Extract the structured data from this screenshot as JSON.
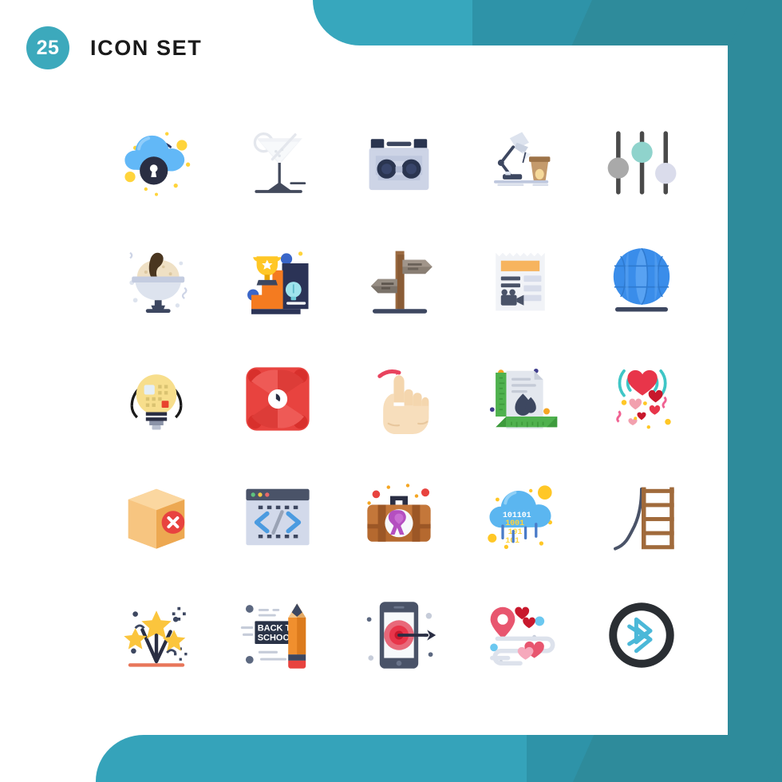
{
  "header": {
    "count_badge": "25",
    "title": "ICON SET"
  },
  "theme": {
    "teal_dark": "#2E8B9B",
    "teal_mid": "#2E93A8",
    "teal_light": "#37A7BD",
    "badge_bg": "#3CA9BC",
    "panel_bg": "#FFFFFF",
    "title_color": "#1A1A1A"
  },
  "grid": {
    "columns": 5,
    "rows": 5,
    "total_icons": 25
  },
  "icons": [
    {
      "index": 1,
      "row": 1,
      "col": 1,
      "name": "cloud-lock-icon",
      "label": "Cloud Security"
    },
    {
      "index": 2,
      "row": 1,
      "col": 2,
      "name": "cocktail-glass-icon",
      "label": "Cocktail"
    },
    {
      "index": 3,
      "row": 1,
      "col": 3,
      "name": "remote-control-icon",
      "label": "Remote Control"
    },
    {
      "index": 4,
      "row": 1,
      "col": 4,
      "name": "desk-lamp-coffee-icon",
      "label": "Desk Lamp"
    },
    {
      "index": 5,
      "row": 1,
      "col": 5,
      "name": "settings-sliders-icon",
      "label": "Settings Sliders"
    },
    {
      "index": 6,
      "row": 2,
      "col": 1,
      "name": "ice-cream-sundae-icon",
      "label": "Ice Cream"
    },
    {
      "index": 7,
      "row": 2,
      "col": 2,
      "name": "trophy-stairs-icon",
      "label": "Success Stairs"
    },
    {
      "index": 8,
      "row": 2,
      "col": 3,
      "name": "signpost-icon",
      "label": "Direction Signpost"
    },
    {
      "index": 9,
      "row": 2,
      "col": 4,
      "name": "news-video-icon",
      "label": "News Video"
    },
    {
      "index": 10,
      "row": 2,
      "col": 5,
      "name": "globe-icon",
      "label": "Globe"
    },
    {
      "index": 11,
      "row": 3,
      "col": 1,
      "name": "lightbulb-circuit-icon",
      "label": "Idea Technology"
    },
    {
      "index": 12,
      "row": 3,
      "col": 2,
      "name": "cooling-fan-icon",
      "label": "Cooling Fan"
    },
    {
      "index": 13,
      "row": 3,
      "col": 3,
      "name": "hand-swipe-gesture-icon",
      "label": "Swipe Gesture"
    },
    {
      "index": 14,
      "row": 3,
      "col": 4,
      "name": "document-ruler-icon",
      "label": "Design Document"
    },
    {
      "index": 15,
      "row": 3,
      "col": 5,
      "name": "heart-signal-icon",
      "label": "Love Broadcast"
    },
    {
      "index": 16,
      "row": 4,
      "col": 1,
      "name": "box-delete-icon",
      "label": "Remove Package"
    },
    {
      "index": 17,
      "row": 4,
      "col": 2,
      "name": "code-window-icon",
      "label": "Coding Window"
    },
    {
      "index": 18,
      "row": 4,
      "col": 3,
      "name": "medical-briefcase-icon",
      "label": "Medical Kit"
    },
    {
      "index": 19,
      "row": 4,
      "col": 4,
      "name": "cloud-binary-data-icon",
      "label": "Cloud Data"
    },
    {
      "index": 20,
      "row": 4,
      "col": 5,
      "name": "ladder-slide-icon",
      "label": "Ladder Slide"
    },
    {
      "index": 21,
      "row": 5,
      "col": 1,
      "name": "firework-stars-icon",
      "label": "Fireworks"
    },
    {
      "index": 22,
      "row": 5,
      "col": 2,
      "name": "back-to-school-pencil-icon",
      "label": "Back To School",
      "text": "BACK TO\nSCHOOL"
    },
    {
      "index": 23,
      "row": 5,
      "col": 3,
      "name": "mobile-target-icon",
      "label": "Mobile Target"
    },
    {
      "index": 24,
      "row": 5,
      "col": 4,
      "name": "love-route-icon",
      "label": "Love Route"
    },
    {
      "index": 25,
      "row": 5,
      "col": 5,
      "name": "bluetooth-icon",
      "label": "Bluetooth"
    }
  ],
  "icon_text": {
    "back_to_school_line1": "BACK TO",
    "back_to_school_line2": "SCHOOL"
  }
}
